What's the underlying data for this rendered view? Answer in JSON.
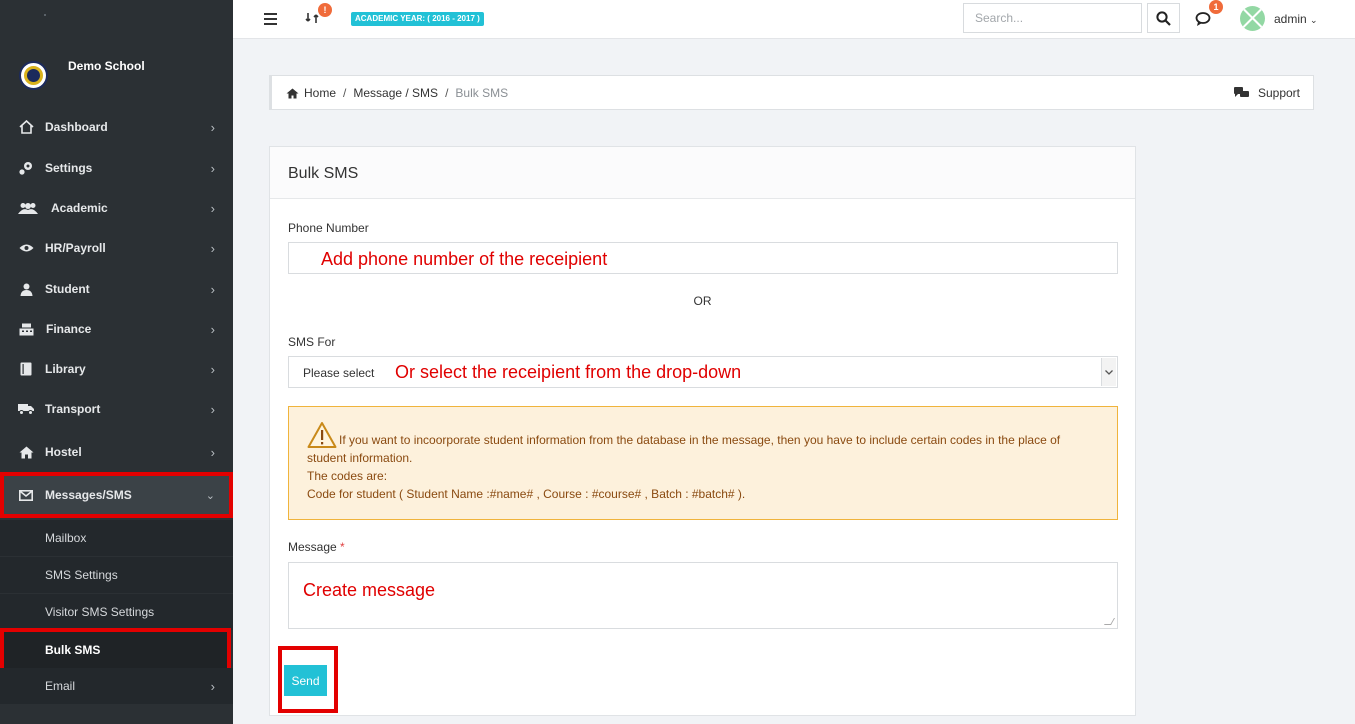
{
  "school": {
    "name": "Demo School"
  },
  "nav": [
    {
      "label": "Dashboard",
      "icon": "home-icon"
    },
    {
      "label": "Settings",
      "icon": "cogs-icon"
    },
    {
      "label": "Academic",
      "icon": "users-icon"
    },
    {
      "label": "HR/Payroll",
      "icon": "eye-icon"
    },
    {
      "label": "Student",
      "icon": "user-icon"
    },
    {
      "label": "Finance",
      "icon": "cash-register-icon"
    },
    {
      "label": "Library",
      "icon": "book-icon"
    },
    {
      "label": "Transport",
      "icon": "truck-icon"
    },
    {
      "label": "Hostel",
      "icon": "house-icon"
    },
    {
      "label": "Messages/SMS",
      "icon": "envelope-icon"
    }
  ],
  "subnav": [
    "Mailbox",
    "SMS Settings",
    "Visitor SMS Settings",
    "Bulk SMS",
    "Email"
  ],
  "topbar": {
    "sync_badge": "!",
    "academic_year": "ACADEMIC YEAR: ( 2016 - 2017 )",
    "search_placeholder": "Search...",
    "chat_badge": "1",
    "user": "admin"
  },
  "breadcrumb": {
    "home": "Home",
    "section": "Message / SMS",
    "current": "Bulk SMS",
    "support": "Support"
  },
  "form": {
    "title": "Bulk SMS",
    "phone_label": "Phone Number",
    "phone_note": "Add phone number of the receipient",
    "or": "OR",
    "sms_for_label": "SMS For",
    "sms_for_value": "Please select",
    "sms_for_note": "Or select the receipient from the drop-down",
    "alert_line1": "If you want to incoorporate student information from the database in the message, then you have to include certain codes in the place of student information.",
    "alert_line2": "The codes are:",
    "alert_line3": "Code for student ( Student Name :#name# , Course : #course# , Batch : #batch# ).",
    "message_label": "Message",
    "message_required": "*",
    "message_note": "Create message",
    "send_label": "Send"
  },
  "colors": {
    "accent": "#22c1d6",
    "sidebar": "#2b3034",
    "highlight": "#e30000",
    "badge": "#f06b3a"
  }
}
